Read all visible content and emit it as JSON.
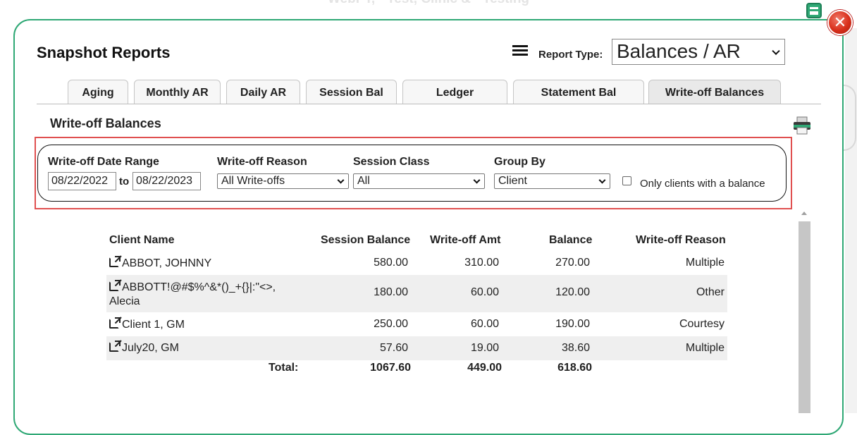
{
  "background_title": "WebPT, - Test, Clinic & - Testing",
  "title": "Snapshot Reports",
  "report_type": {
    "label": "Report Type:",
    "value": "Balances / AR"
  },
  "tabs": [
    {
      "label": "Aging"
    },
    {
      "label": "Monthly AR"
    },
    {
      "label": "Daily AR"
    },
    {
      "label": "Session Bal"
    },
    {
      "label": "Ledger"
    },
    {
      "label": "Statement Bal"
    },
    {
      "label": "Write-off Balances",
      "active": true
    }
  ],
  "section_title": "Write-off Balances",
  "filters": {
    "date_range_label": "Write-off Date Range",
    "date_from": "08/22/2022",
    "to_label": "to",
    "date_to": "08/22/2023",
    "reason_label": "Write-off Reason",
    "reason_value": "All Write-offs",
    "session_class_label": "Session Class",
    "session_class_value": "All",
    "group_by_label": "Group By",
    "group_by_value": "Client",
    "only_balance_label": "Only clients with a balance",
    "only_balance_checked": false
  },
  "table": {
    "headers": {
      "client_name": "Client Name",
      "session_balance": "Session Balance",
      "writeoff_amt": "Write-off Amt",
      "balance": "Balance",
      "writeoff_reason": "Write-off Reason"
    },
    "rows": [
      {
        "name": "ABBOT, JOHNNY",
        "name2": "",
        "session_balance": "580.00",
        "writeoff_amt": "310.00",
        "balance": "270.00",
        "reason": "Multiple"
      },
      {
        "name": "ABBOTT!@#$%^&*()_+{}|:\"<>,",
        "name2": "Alecia",
        "session_balance": "180.00",
        "writeoff_amt": "60.00",
        "balance": "120.00",
        "reason": "Other"
      },
      {
        "name": "Client 1, GM",
        "name2": "",
        "session_balance": "250.00",
        "writeoff_amt": "60.00",
        "balance": "190.00",
        "reason": "Courtesy"
      },
      {
        "name": "July20, GM",
        "name2": "",
        "session_balance": "57.60",
        "writeoff_amt": "19.00",
        "balance": "38.60",
        "reason": "Multiple"
      }
    ],
    "total": {
      "label": "Total:",
      "session_balance": "1067.60",
      "writeoff_amt": "449.00",
      "balance": "618.60"
    }
  },
  "icons": [
    "menu-icon",
    "close-icon",
    "minimize-icon",
    "printer-icon",
    "external-link-icon"
  ],
  "colors": {
    "accent": "#2fa875",
    "highlight": "#e05050",
    "close": "#d9301c"
  }
}
